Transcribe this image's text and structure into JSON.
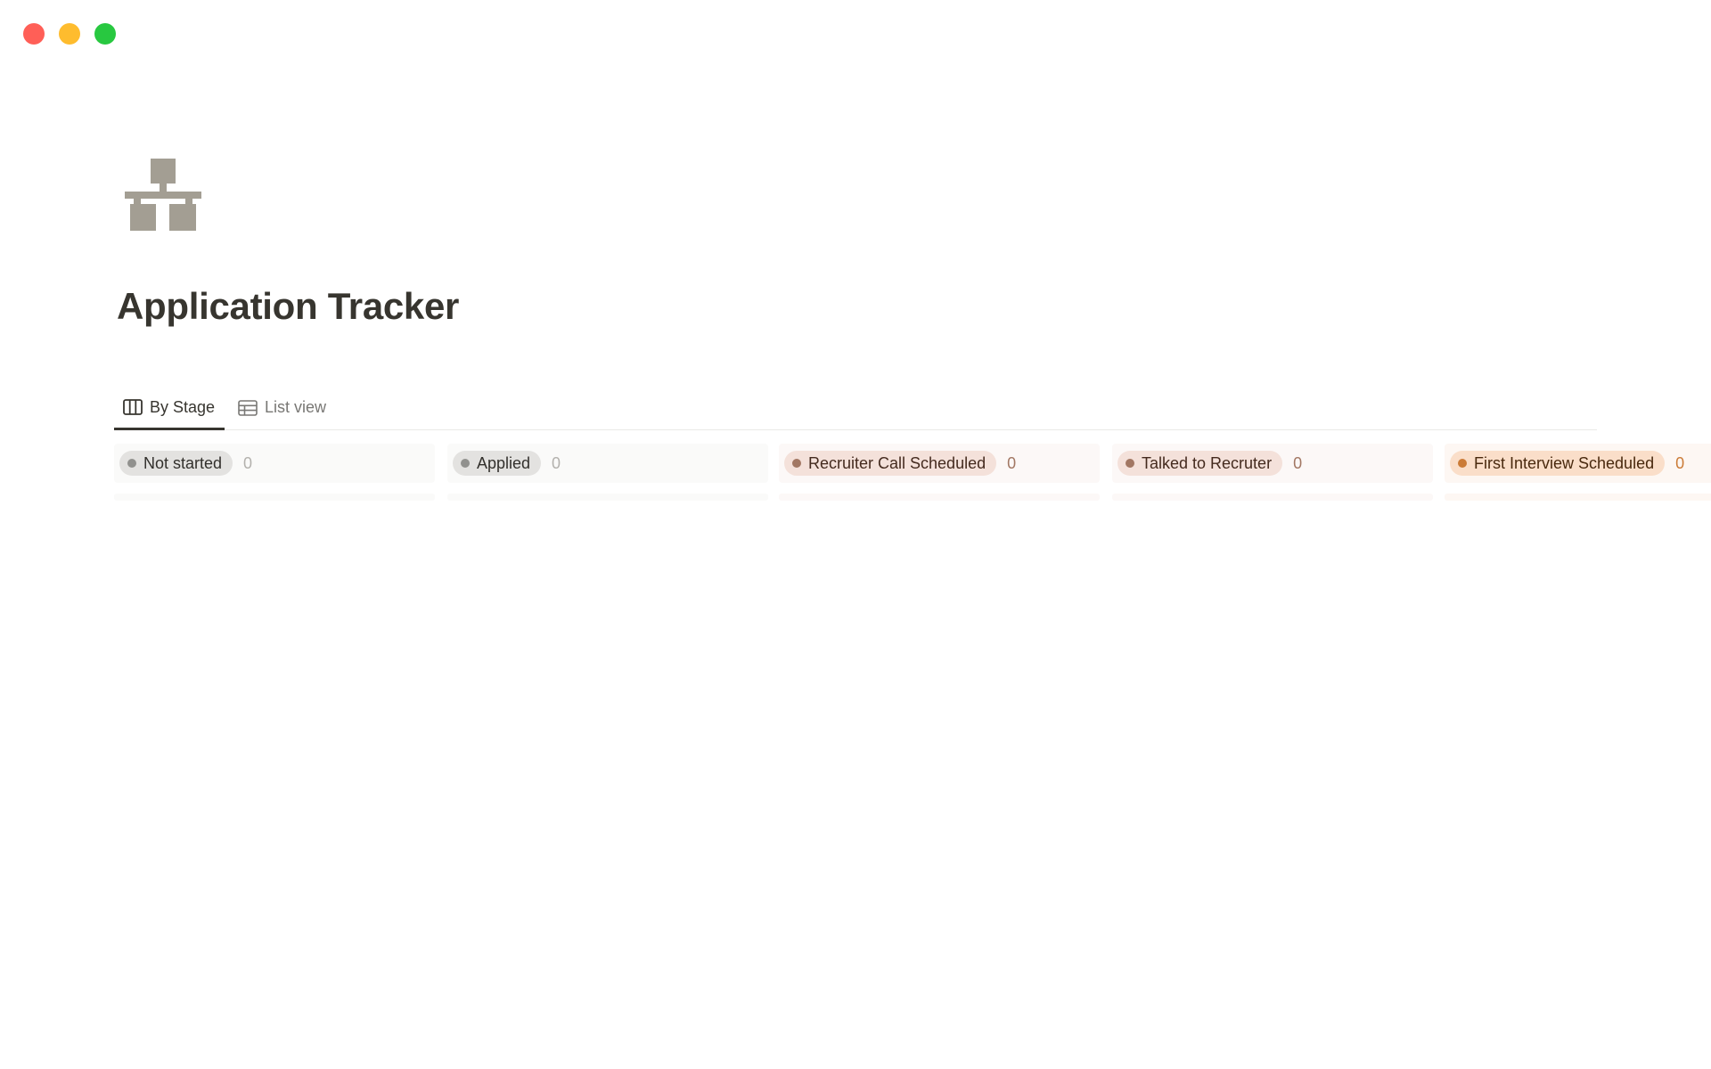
{
  "window": {
    "controls": [
      {
        "name": "close",
        "color": "#ff5f57"
      },
      {
        "name": "minimize",
        "color": "#febc2e"
      },
      {
        "name": "zoom",
        "color": "#28c840"
      }
    ]
  },
  "page": {
    "icon": "sitemap-icon",
    "icon_color": "#a39e93",
    "title": "Application Tracker"
  },
  "views": {
    "tabs": [
      {
        "label": "By Stage",
        "icon": "board-icon",
        "active": true
      },
      {
        "label": "List view",
        "icon": "table-icon",
        "active": false
      }
    ]
  },
  "board": {
    "columns": [
      {
        "label": "Not started",
        "count": "0",
        "pill_bg": "#e3e2e0",
        "dot": "#91918e",
        "count_color": "#b3b1ad",
        "header_bg": "#fafaf9",
        "text": "#32302c"
      },
      {
        "label": "Applied",
        "count": "0",
        "pill_bg": "#e3e2e0",
        "dot": "#91918e",
        "count_color": "#b3b1ad",
        "header_bg": "#fafaf9",
        "text": "#32302c"
      },
      {
        "label": "Recruiter Call Scheduled",
        "count": "0",
        "pill_bg": "#f4e1da",
        "dot": "#a27763",
        "count_color": "#a27763",
        "header_bg": "#fcf8f7",
        "text": "#442a1e"
      },
      {
        "label": "Talked to Recruter",
        "count": "0",
        "pill_bg": "#f4e1da",
        "dot": "#a27763",
        "count_color": "#a27763",
        "header_bg": "#fcf8f7",
        "text": "#442a1e"
      },
      {
        "label": "First Interview Scheduled",
        "count": "0",
        "pill_bg": "#fadec9",
        "dot": "#cb7b37",
        "count_color": "#cb7b37",
        "header_bg": "#fdf7f3",
        "text": "#49290e"
      }
    ]
  }
}
